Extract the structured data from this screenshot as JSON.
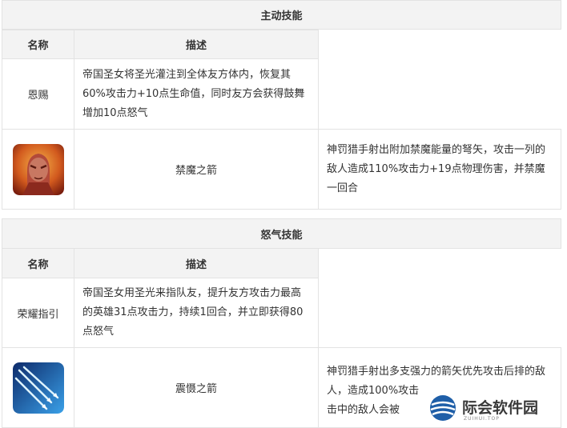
{
  "active": {
    "title": "主动技能",
    "col_name": "名称",
    "col_desc": "描述",
    "row1": {
      "name": "恩赐",
      "desc": "帝国圣女将圣光灌注到全体友方体内，恢复其60%攻击力+10点生命值，同时友方会获得鼓舞增加10点怒气"
    },
    "row2": {
      "icon": "red-warrior-portrait-icon",
      "name": "禁魔之箭",
      "desc": "神罚猎手射出附加禁魔能量的弩矢，攻击一列的敌人造成110%攻击力+19点物理伤害，并禁魔一回合"
    }
  },
  "rage": {
    "title": "怒气技能",
    "col_name": "名称",
    "col_desc": "描述",
    "row1": {
      "name": "荣耀指引",
      "desc": "帝国圣女用圣光来指队友，提升友方攻击力最高的英雄31点攻击力，持续1回合，并立即获得80点怒气"
    },
    "row2": {
      "icon": "blue-arrows-icon",
      "name": "震慑之箭",
      "desc": "神罚猎手射出多支强力的箭矢优先攻击后排的敌人，造成100%攻击",
      "desc_line3": "击中的敌人会被"
    }
  },
  "watermark": {
    "text": "际会软件园",
    "sub": "ZUIHUI.TOP"
  },
  "colors": {
    "header_bg": "#f3f3f3",
    "border": "#e3e3e3",
    "text": "#333333"
  }
}
